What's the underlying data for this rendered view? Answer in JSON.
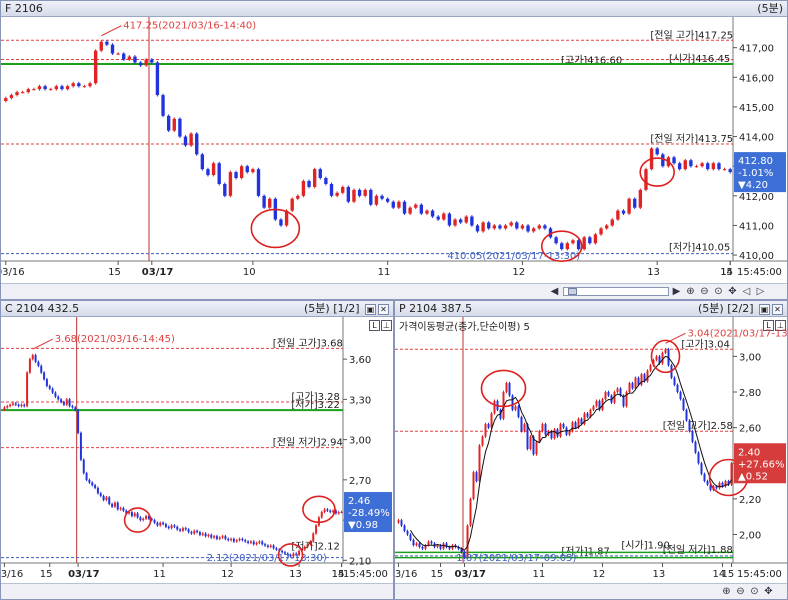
{
  "top": {
    "title": "F 2106",
    "interval": "(5분)",
    "price_box": {
      "price": "412.80",
      "pct": "-1.01%",
      "chg": "▼4.20",
      "color": "#3d6fd6"
    },
    "max_label": "417.25(2021/03/16-14:40)",
    "min_label": "410.05(2021/03/17-13:30)",
    "ref_labels": [
      "[전일 고가]417.25",
      "[고가]416.60",
      "[시가]416.45",
      "[전일 저가]413.75",
      "[저가]410.05"
    ],
    "time_label": "15:45:00"
  },
  "left": {
    "title": "C 2104 432.5",
    "interval": "(5분)",
    "page": "[1/2]",
    "price_box": {
      "price": "2.46",
      "pct": "-28.49%",
      "chg": "▼0.98",
      "color": "#3d6fd6"
    },
    "max_label": "3.68(2021/03/16-14:45)",
    "min_label": "2.12(2021/03/17-13:30)",
    "ref_labels": [
      "[전일 고가]3.68",
      "[고가]3.28",
      "[저가]3.22",
      "[전일 저가]2.94",
      "[저가]2.12"
    ],
    "time_label": "15:45:00"
  },
  "right": {
    "title": "P 2104 387.5",
    "interval": "(5분)",
    "page": "[2/2]",
    "indicator": "가격이동평균(종가,단순이평) 5",
    "price_box": {
      "price": "2.40",
      "pct": "+27.66%",
      "chg": "▲0.52",
      "color": "#d63c3c"
    },
    "max_label": "3.04(2021/03/17-13:30)",
    "min_label": "1.87(2021/03/17-09:05)",
    "ref_labels": [
      "[고가]3.04",
      "[전일 고가]2.58",
      "[저가]1.87",
      "[시가]1.90",
      "[전일 저가]1.88"
    ],
    "time_label": "15:45:00"
  },
  "colors": {
    "up": "#e02424",
    "down": "#2233dd",
    "green": "#1aa01a",
    "ref_red": "#e04040",
    "ref_blue": "#4060c0",
    "circle": "#dd2020"
  },
  "chart_data": [
    {
      "type": "candlestick",
      "name": "F 2106",
      "ylim": [
        409.8,
        417.9
      ],
      "y_ticks": [
        410.0,
        411.0,
        412.0,
        413.0,
        414.0,
        415.0,
        416.0,
        417.0
      ],
      "y_tick_labels": [
        "410,00",
        "411,00",
        "412,00",
        "413,00",
        "414,00",
        "415,00",
        "416,00",
        "417,00"
      ],
      "x_labels": [
        "03/16",
        "15",
        "03/17",
        "10",
        "11",
        "12",
        "13",
        "14",
        "15"
      ],
      "x_label_bars": [
        0,
        20,
        26,
        44,
        68,
        92,
        116,
        140,
        164
      ],
      "session_break_bar": 26,
      "close": [
        415.3,
        415.4,
        415.5,
        415.5,
        415.6,
        415.6,
        415.7,
        415.6,
        415.6,
        415.7,
        415.6,
        415.7,
        415.8,
        415.7,
        415.7,
        415.8,
        416.9,
        417.2,
        417.1,
        416.8,
        416.8,
        416.6,
        416.7,
        416.5,
        416.4,
        416.6,
        416.5,
        415.4,
        414.7,
        414.2,
        414.6,
        414.0,
        413.7,
        414.1,
        413.4,
        412.9,
        412.7,
        413.1,
        412.4,
        412.0,
        412.8,
        412.6,
        413.0,
        412.8,
        412.9,
        412.0,
        411.6,
        411.9,
        411.2,
        411.0,
        411.5,
        411.9,
        412.0,
        412.5,
        412.3,
        412.9,
        412.6,
        412.4,
        412.0,
        412.1,
        412.3,
        411.8,
        412.2,
        412.0,
        412.2,
        411.7,
        412.0,
        411.9,
        411.8,
        411.6,
        411.8,
        411.4,
        411.6,
        411.7,
        411.4,
        411.5,
        411.3,
        411.2,
        411.4,
        411.0,
        411.2,
        411.1,
        411.3,
        411.0,
        410.8,
        411.1,
        410.9,
        411.0,
        410.9,
        411.0,
        411.1,
        410.9,
        411.0,
        410.8,
        410.9,
        411.0,
        410.9,
        410.6,
        410.4,
        410.2,
        410.4,
        410.5,
        410.2,
        410.6,
        410.4,
        410.7,
        410.9,
        411.0,
        411.2,
        411.5,
        411.4,
        411.9,
        411.6,
        412.2,
        412.9,
        413.6,
        413.4,
        413.0,
        413.3,
        413.1,
        412.9,
        413.2,
        413.0,
        413.0,
        413.1,
        412.9,
        413.1,
        412.9,
        412.9,
        412.8
      ],
      "open": [
        415.2,
        415.3,
        415.4,
        415.5,
        415.5,
        415.6,
        415.6,
        415.7,
        415.6,
        415.6,
        415.7,
        415.6,
        415.7,
        415.8,
        415.7,
        415.7,
        415.8,
        416.9,
        417.2,
        417.1,
        416.8,
        416.8,
        416.6,
        416.7,
        416.5,
        416.4,
        416.6,
        416.5,
        415.4,
        414.7,
        414.2,
        414.6,
        414.0,
        413.7,
        414.1,
        413.4,
        412.9,
        412.7,
        413.1,
        412.4,
        412.0,
        412.8,
        412.6,
        413.0,
        412.8,
        412.9,
        412.0,
        411.6,
        411.9,
        411.2,
        411.0,
        411.5,
        411.9,
        412.0,
        412.5,
        412.3,
        412.9,
        412.6,
        412.4,
        412.0,
        412.1,
        412.3,
        411.8,
        412.2,
        412.0,
        412.2,
        411.7,
        412.0,
        411.9,
        411.8,
        411.6,
        411.8,
        411.4,
        411.6,
        411.7,
        411.4,
        411.5,
        411.3,
        411.2,
        411.4,
        411.0,
        411.2,
        411.1,
        411.3,
        411.0,
        410.8,
        411.1,
        410.9,
        411.0,
        410.9,
        411.0,
        411.1,
        410.9,
        411.0,
        410.8,
        410.9,
        411.0,
        410.9,
        410.6,
        410.4,
        410.2,
        410.4,
        410.5,
        410.2,
        410.6,
        410.4,
        410.7,
        410.9,
        411.0,
        411.2,
        411.5,
        411.4,
        411.9,
        411.6,
        412.2,
        412.9,
        413.6,
        413.4,
        413.0,
        413.3,
        413.1,
        412.9,
        413.2,
        413.0,
        413.0,
        413.1,
        412.9,
        413.1,
        412.9,
        412.9
      ],
      "reference_lines": [
        417.25,
        416.6,
        416.45,
        413.75,
        410.05
      ]
    },
    {
      "type": "candlestick",
      "name": "C 2104 432.5",
      "ylim": [
        2.08,
        3.78
      ],
      "y_ticks": [
        2.1,
        2.4,
        2.7,
        3.0,
        3.3,
        3.6
      ],
      "y_tick_labels": [
        "2,10",
        "2,40",
        "2,70",
        "3,00",
        "3,30",
        "3,60"
      ],
      "x_labels": [
        "03/16",
        "15",
        "03/17",
        "11",
        "12",
        "13",
        "14",
        "15"
      ],
      "x_label_bars": [
        0,
        16,
        26,
        56,
        80,
        104,
        128,
        148
      ],
      "session_break_bar": 26,
      "close": [
        3.24,
        3.25,
        3.26,
        3.27,
        3.26,
        3.25,
        3.26,
        3.25,
        3.5,
        3.6,
        3.63,
        3.58,
        3.55,
        3.5,
        3.45,
        3.4,
        3.38,
        3.35,
        3.32,
        3.3,
        3.28,
        3.26,
        3.3,
        3.25,
        3.24,
        3.22,
        3.05,
        2.85,
        2.75,
        2.7,
        2.68,
        2.66,
        2.64,
        2.6,
        2.58,
        2.55,
        2.57,
        2.52,
        2.5,
        2.53,
        2.48,
        2.49,
        2.47,
        2.45,
        2.46,
        2.43,
        2.45,
        2.42,
        2.4,
        2.41,
        2.43,
        2.41,
        2.4,
        2.38,
        2.36,
        2.38,
        2.37,
        2.35,
        2.34,
        2.36,
        2.35,
        2.33,
        2.32,
        2.34,
        2.33,
        2.31,
        2.3,
        2.32,
        2.31,
        2.29,
        2.3,
        2.28,
        2.29,
        2.27,
        2.28,
        2.26,
        2.27,
        2.28,
        2.26,
        2.25,
        2.26,
        2.24,
        2.25,
        2.26,
        2.25,
        2.24,
        2.23,
        2.24,
        2.22,
        2.23,
        2.24,
        2.22,
        2.21,
        2.2,
        2.21,
        2.19,
        2.18,
        2.17,
        2.16,
        2.15,
        2.14,
        2.13,
        2.15,
        2.14,
        2.17,
        2.18,
        2.2,
        2.22,
        2.24,
        2.3,
        2.36,
        2.42,
        2.46,
        2.48,
        2.47,
        2.46,
        2.47,
        2.45,
        2.46,
        2.46
      ],
      "reference_lines": [
        3.68,
        3.28,
        3.22,
        2.94,
        2.12
      ]
    },
    {
      "type": "candlestick",
      "name": "P 2104 387.5",
      "indicator": "가격이동평균(종가,단순이평) 5",
      "ylim": [
        1.84,
        3.12
      ],
      "y_ticks": [
        2.0,
        2.2,
        2.4,
        2.6,
        2.8,
        3.0
      ],
      "y_tick_labels": [
        "2,00",
        "2,20",
        "2,40",
        "2,60",
        "2,80",
        "3,00"
      ],
      "x_labels": [
        "03/16",
        "15",
        "03/17",
        "11",
        "12",
        "13",
        "14",
        "15"
      ],
      "x_label_bars": [
        0,
        14,
        22,
        48,
        68,
        88,
        108,
        124
      ],
      "session_break_bar": 22,
      "close": [
        2.08,
        2.05,
        2.02,
        2.0,
        1.97,
        1.94,
        1.95,
        1.93,
        1.92,
        1.94,
        1.96,
        1.95,
        1.93,
        1.94,
        1.92,
        1.95,
        1.93,
        1.92,
        1.94,
        1.93,
        1.92,
        1.9,
        1.87,
        2.05,
        2.2,
        2.35,
        2.3,
        2.5,
        2.55,
        2.62,
        2.6,
        2.68,
        2.75,
        2.7,
        2.65,
        2.8,
        2.85,
        2.78,
        2.7,
        2.72,
        2.66,
        2.58,
        2.62,
        2.48,
        2.55,
        2.45,
        2.52,
        2.58,
        2.62,
        2.56,
        2.58,
        2.54,
        2.59,
        2.55,
        2.62,
        2.6,
        2.56,
        2.58,
        2.63,
        2.6,
        2.65,
        2.62,
        2.68,
        2.66,
        2.7,
        2.72,
        2.75,
        2.7,
        2.76,
        2.8,
        2.78,
        2.74,
        2.8,
        2.82,
        2.78,
        2.72,
        2.8,
        2.85,
        2.82,
        2.88,
        2.84,
        2.9,
        2.86,
        2.92,
        2.95,
        2.98,
        3.0,
        2.96,
        3.02,
        3.04,
        2.95,
        2.88,
        2.84,
        2.8,
        2.76,
        2.7,
        2.64,
        2.58,
        2.52,
        2.46,
        2.4,
        2.34,
        2.3,
        2.28,
        2.25,
        2.27,
        2.26,
        2.29,
        2.27,
        2.3,
        2.28,
        2.4
      ],
      "reference_lines": [
        3.04,
        2.58,
        1.87,
        1.9,
        1.88
      ]
    }
  ]
}
